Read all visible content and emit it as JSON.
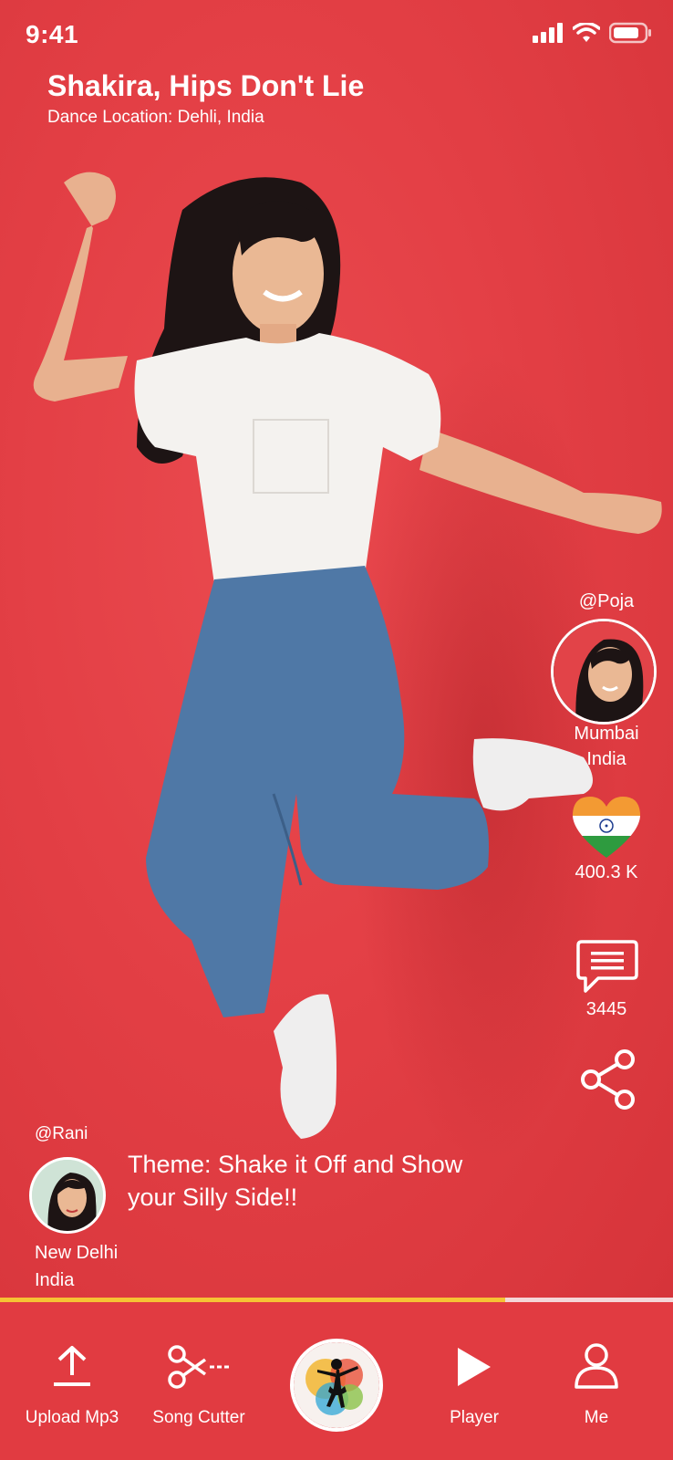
{
  "status_bar": {
    "time": "9:41"
  },
  "header": {
    "song_title": "Shakira, Hips Don't Lie",
    "dance_location": "Dance Location: Dehli, India"
  },
  "poster": {
    "handle": "@Poja",
    "city_line1": "Mumbai",
    "city_line2": "India",
    "likes": "400.3 K",
    "comments": "3445"
  },
  "theme": {
    "handle": "@Rani",
    "text_line1": "Theme: Shake it Off and Show",
    "text_line2": "your Silly Side!!",
    "city_line1": "New Delhi",
    "city_line2": "India"
  },
  "playback": {
    "progress_fraction": 0.75
  },
  "nav": {
    "upload": "Upload Mp3",
    "cutter": "Song Cutter",
    "player": "Player",
    "me": "Me"
  },
  "colors": {
    "background": "#e23d43",
    "progress": "#f6c234",
    "text": "#ffffff"
  }
}
